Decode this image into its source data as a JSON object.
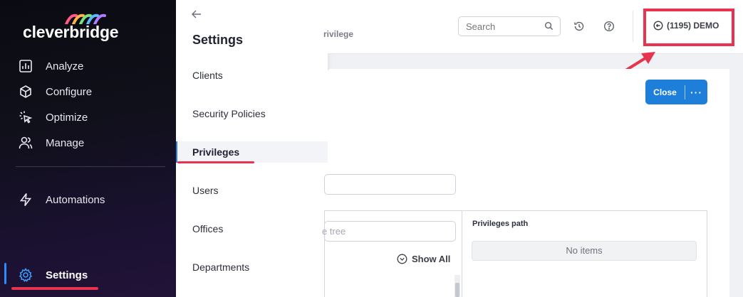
{
  "brand": {
    "logo_text": "cleverbridge"
  },
  "sidebar": {
    "items": [
      {
        "label": "Analyze",
        "icon": "chart-icon"
      },
      {
        "label": "Configure",
        "icon": "cube-icon"
      },
      {
        "label": "Optimize",
        "icon": "cursor-click-icon"
      },
      {
        "label": "Manage",
        "icon": "users-icon"
      },
      {
        "label": "Automations",
        "icon": "lightning-icon"
      },
      {
        "label": "Settings",
        "icon": "gear-icon",
        "active": true
      }
    ]
  },
  "submenu": {
    "title": "Settings",
    "items": [
      "Clients",
      "Security Policies",
      "Privileges",
      "Users",
      "Offices",
      "Departments"
    ],
    "active_item": "Privileges"
  },
  "header": {
    "breadcrumb_tail": "rivilege",
    "search_placeholder": "Search",
    "account_label": "(1195) DEMO"
  },
  "card": {
    "close_label": "Close",
    "more_label": "···",
    "tree_search_placeholder": "e tree",
    "show_all_label": "Show All",
    "privileges_path_label": "Privileges path",
    "no_items_label": "No items"
  },
  "colors": {
    "accent": "#1d7fd9",
    "annotation": "#e8334f",
    "sidebar_bg": "#0a0b12"
  }
}
